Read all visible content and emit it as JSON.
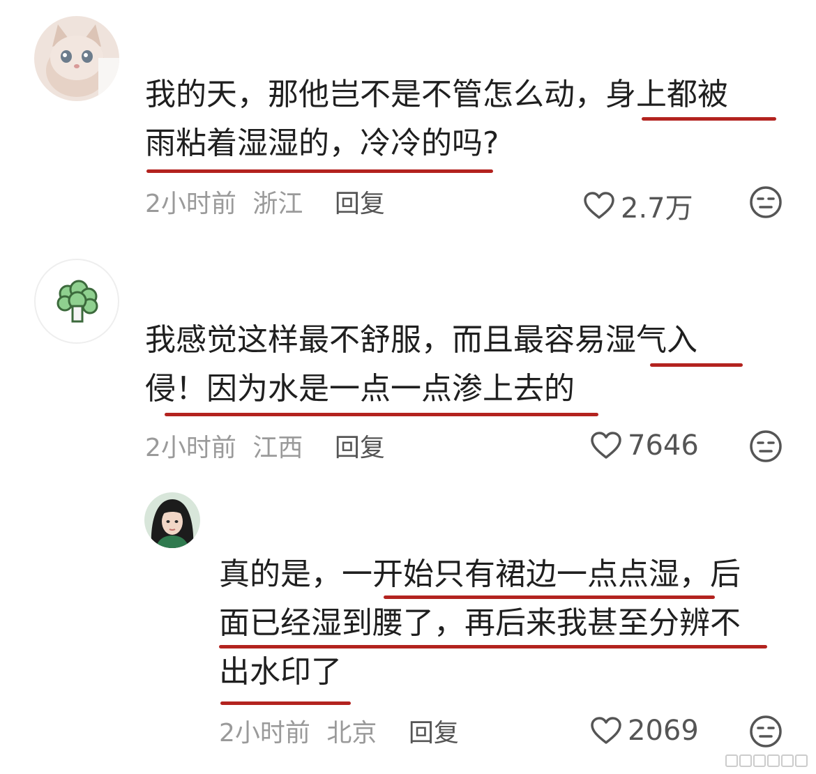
{
  "comments": [
    {
      "lines": [
        "我的天，那他岂不是不管怎么动，身上都被",
        "雨粘着湿湿的，冷冷的吗?"
      ],
      "time": "2小时前",
      "location": "浙江",
      "reply_label": "回复",
      "likes": "2.7万"
    },
    {
      "lines": [
        "我感觉这样最不舒服，而且最容易湿气入",
        "侵！因为水是一点一点渗上去的"
      ],
      "time": "2小时前",
      "location": "江西",
      "reply_label": "回复",
      "likes": "7646"
    },
    {
      "lines": [
        "真的是，一开始只有裙边一点点湿，后",
        "面已经湿到腰了，再后来我甚至分辨不",
        "出水印了"
      ],
      "time": "2小时前",
      "location": "北京",
      "reply_label": "回复",
      "likes": "2069"
    }
  ],
  "colors": {
    "underline": "#b3231f",
    "meta": "#9a9a9a",
    "text": "#1f1f1f"
  },
  "icons": [
    "heart-outline-icon",
    "expressionless-face-icon",
    "broccoli-icon"
  ]
}
